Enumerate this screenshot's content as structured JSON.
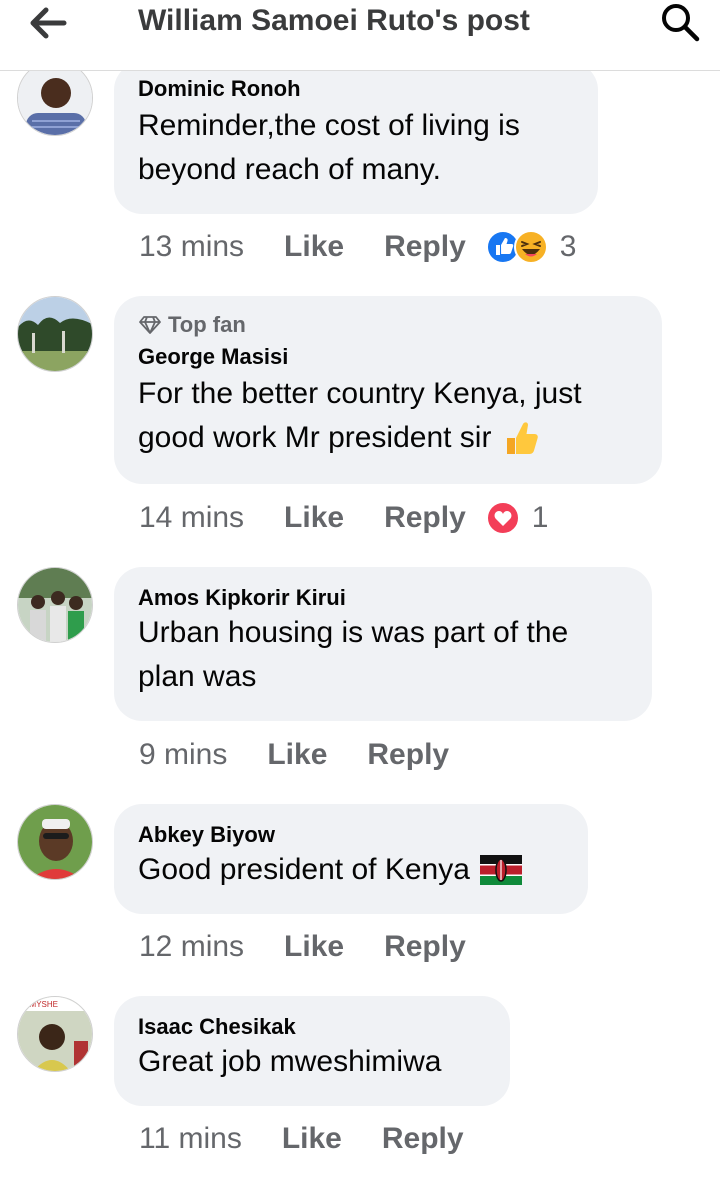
{
  "header": {
    "title": "William Samoei Ruto's post",
    "back_icon": "arrow-left-icon",
    "search_icon": "search-icon"
  },
  "comments": [
    {
      "author": "Dominic Ronoh",
      "text_lines": [
        "Reminder,the cost of living is",
        "beyond reach of many."
      ],
      "time": "13 mins",
      "like": "Like",
      "reply": "Reply",
      "reaction_icons": [
        "like-reaction-icon",
        "haha-reaction-icon"
      ],
      "reaction_count": "3"
    },
    {
      "badge": "Top fan",
      "badge_icon": "diamond-icon",
      "author": "George Masisi",
      "text_lines": [
        "For the better country Kenya, just",
        "good work Mr president sir"
      ],
      "emoji_icon": "thumbs-up-emoji-icon",
      "time": "14 mins",
      "like": "Like",
      "reply": "Reply",
      "reaction_icons": [
        "love-reaction-icon"
      ],
      "reaction_count": "1"
    },
    {
      "author": "Amos Kipkorir Kirui",
      "text_lines": [
        "Urban housing is was part of the",
        "plan was"
      ],
      "time": "9 mins",
      "like": "Like",
      "reply": "Reply"
    },
    {
      "author": "Abkey Biyow",
      "text_lines": [
        "Good president of Kenya"
      ],
      "emoji_icon": "kenya-flag-emoji-icon",
      "time": "12 mins",
      "like": "Like",
      "reply": "Reply"
    },
    {
      "author": "Isaac Chesikak",
      "text_lines": [
        "Great job mweshimiwa"
      ],
      "avatar_overlay_text": "S MYSHE",
      "time": "11 mins",
      "like": "Like",
      "reply": "Reply"
    }
  ],
  "colors": {
    "bubble": "#f0f2f5",
    "secondary_text": "#65676b",
    "like_blue": "#1877f2",
    "love_red": "#f33e58"
  }
}
